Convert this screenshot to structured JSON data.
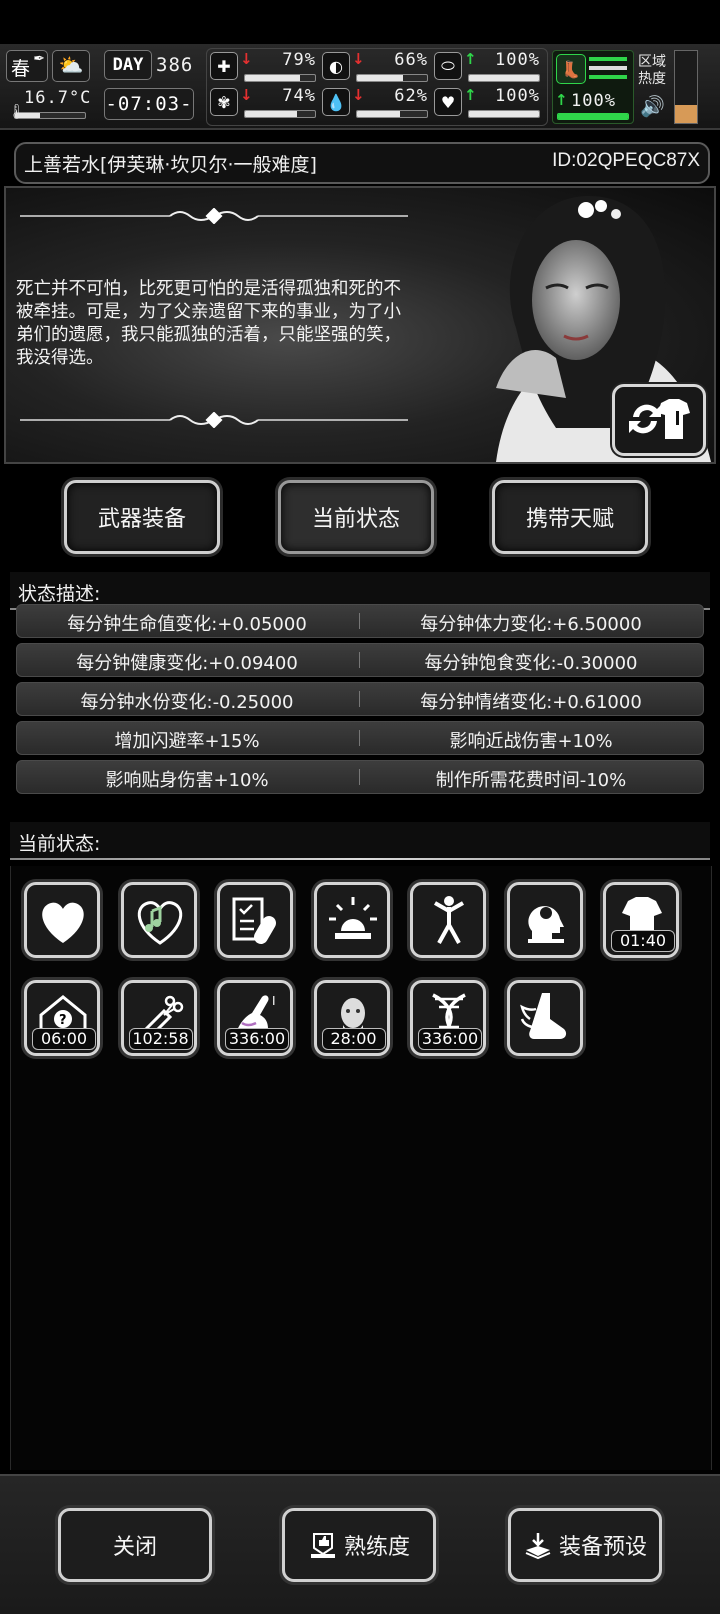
{
  "hud": {
    "season": "春",
    "temperature": "16.7°C",
    "day_label": "DAY",
    "day_number": "386",
    "clock": "-07:03-",
    "region_heat_label": "区域\n热度",
    "stats": [
      {
        "icon": "medkit-icon",
        "trend": "down",
        "value": "79%",
        "fill": 0.79
      },
      {
        "icon": "stomach-icon",
        "trend": "down",
        "value": "66%",
        "fill": 0.66
      },
      {
        "icon": "pill-icon",
        "trend": "up",
        "value": "100%",
        "fill": 1.0
      },
      {
        "icon": "brain-icon",
        "trend": "down",
        "value": "74%",
        "fill": 0.74
      },
      {
        "icon": "water-drop-icon",
        "trend": "down",
        "value": "62%",
        "fill": 0.62
      },
      {
        "icon": "heart-icon",
        "trend": "up",
        "value": "100%",
        "fill": 1.0
      },
      {
        "icon": "boot-icon",
        "trend": "up",
        "value": "100%",
        "fill": 1.0
      }
    ],
    "colors": {
      "down": "#e53030",
      "up": "#2fd64a",
      "stamina": "#2fd64a"
    }
  },
  "title_bar": {
    "name": "上善若水[伊芙琳·坎贝尔·一般难度]",
    "id": "ID:02QPEQC87X"
  },
  "portrait": {
    "quote": "死亡并不可怕，比死更可怕的是活得孤独和死的不被牵挂。可是，为了父亲遗留下来的事业，为了小弟们的遗愿，我只能孤独的活着，只能坚强的笑，我没得选。"
  },
  "tabs": [
    {
      "label": "武器装备",
      "active": false
    },
    {
      "label": "当前状态",
      "active": true
    },
    {
      "label": "携带天赋",
      "active": false
    }
  ],
  "status_desc": {
    "heading": "状态描述:",
    "rows": [
      [
        "每分钟生命值变化:+0.05000",
        "每分钟体力变化:+6.50000"
      ],
      [
        "每分钟健康变化:+0.09400",
        "每分钟饱食变化:-0.30000"
      ],
      [
        "每分钟水份变化:-0.25000",
        "每分钟情绪变化:+0.61000"
      ],
      [
        "增加闪避率+15%",
        "影响近战伤害+10%"
      ],
      [
        "影响贴身伤害+10%",
        "制作所需花费时间-10%"
      ]
    ]
  },
  "current_status": {
    "heading": "当前状态:",
    "icons": [
      {
        "name": "heart-icon",
        "timer": ""
      },
      {
        "name": "music-heart-icon",
        "timer": ""
      },
      {
        "name": "clipboard-pill-icon",
        "timer": ""
      },
      {
        "name": "alarm-light-icon",
        "timer": ""
      },
      {
        "name": "stretching-person-icon",
        "timer": ""
      },
      {
        "name": "head-profile-icon",
        "timer": ""
      },
      {
        "name": "shirt-icon",
        "timer": "01:40"
      },
      {
        "name": "house-question-icon",
        "timer": "06:00"
      },
      {
        "name": "syringe-scissors-icon",
        "timer": "102:58"
      },
      {
        "name": "injured-arm-icon",
        "timer": "336:00"
      },
      {
        "name": "old-man-icon",
        "timer": "28:00"
      },
      {
        "name": "dna-icon",
        "timer": "336:00"
      },
      {
        "name": "wing-boot-icon",
        "timer": ""
      }
    ]
  },
  "bottom": {
    "close": "关闭",
    "proficiency": "熟练度",
    "equip_preset": "装备预设"
  }
}
